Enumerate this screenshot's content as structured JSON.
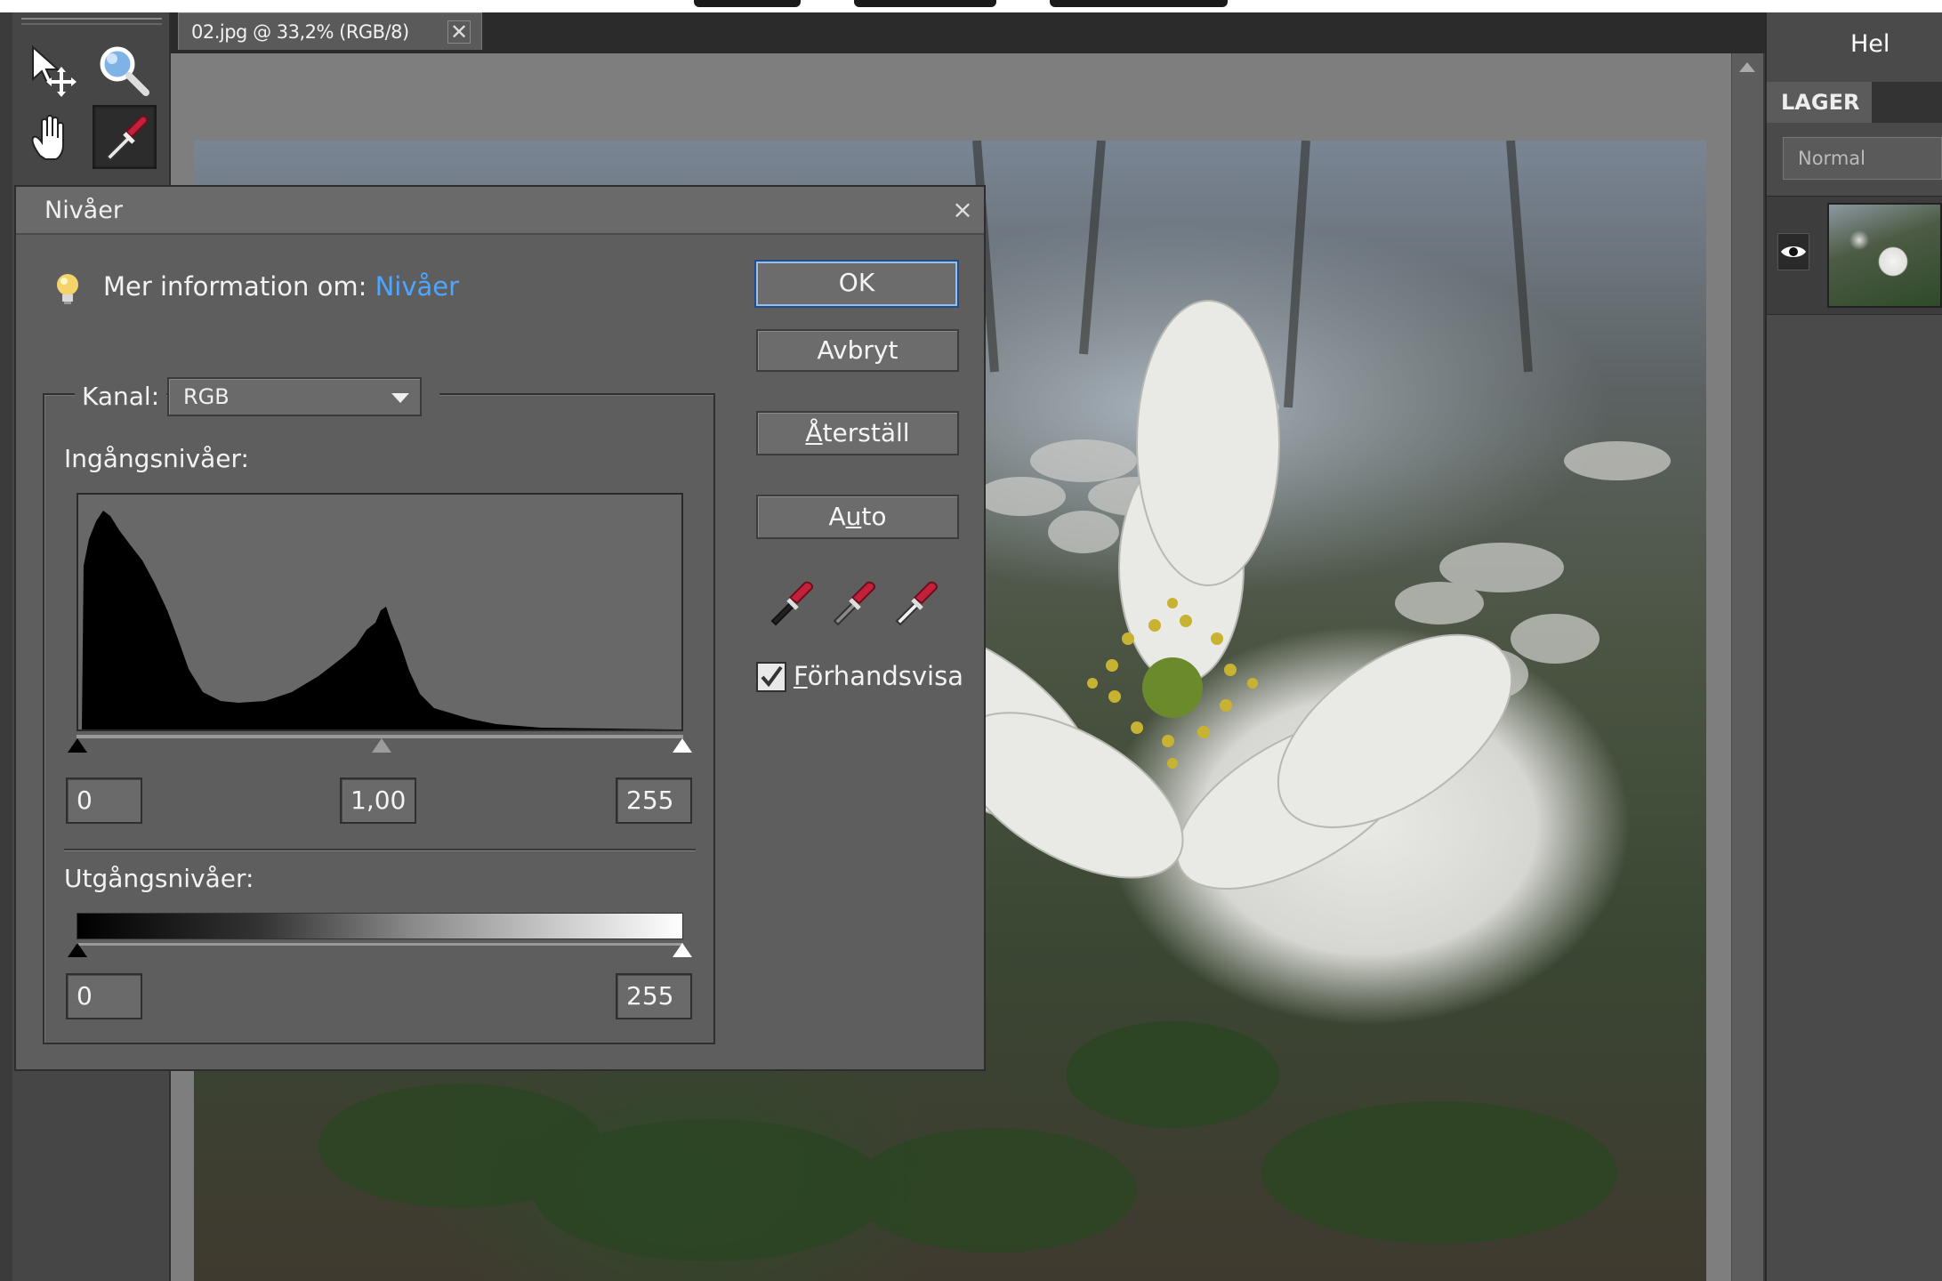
{
  "document": {
    "tab_label": "02.jpg @ 33,2% (RGB/8)",
    "close_glyph": "✕"
  },
  "right_panel": {
    "title": "Hel",
    "layers_tab": "LAGER",
    "blend_mode": "Normal"
  },
  "dialog": {
    "title": "Nivåer",
    "close_glyph": "×",
    "info_prefix": "Mer information om: ",
    "info_link": "Nivåer",
    "buttons": {
      "ok": "OK",
      "cancel": "Avbryt",
      "reset_first": "Å",
      "reset_rest": "terställ",
      "auto_first": "A",
      "auto_u": "u",
      "auto_rest": "to"
    },
    "preview_first": "F",
    "preview_rest": "örhandsvisa",
    "preview_checked": true,
    "channel_label": "Kanal:",
    "channel_value": "RGB",
    "input_label": "Ingångsnivåer:",
    "output_label": "Utgångsnivåer:",
    "input_black": "0",
    "input_gamma": "1,00",
    "input_white": "255",
    "output_black": "0",
    "output_white": "255"
  },
  "icons": {
    "move_tool": "move-tool-icon",
    "zoom_tool": "zoom-icon",
    "hand_tool": "hand-icon",
    "eyedropper_tool": "eyedropper-icon",
    "info": "lightbulb-icon",
    "visibility": "eye-icon"
  },
  "colors": {
    "link": "#4da6ff",
    "ok_border": "#1e4f8a",
    "dialog_bg": "#5e5e5e",
    "dropper_red": "#c4203a"
  }
}
